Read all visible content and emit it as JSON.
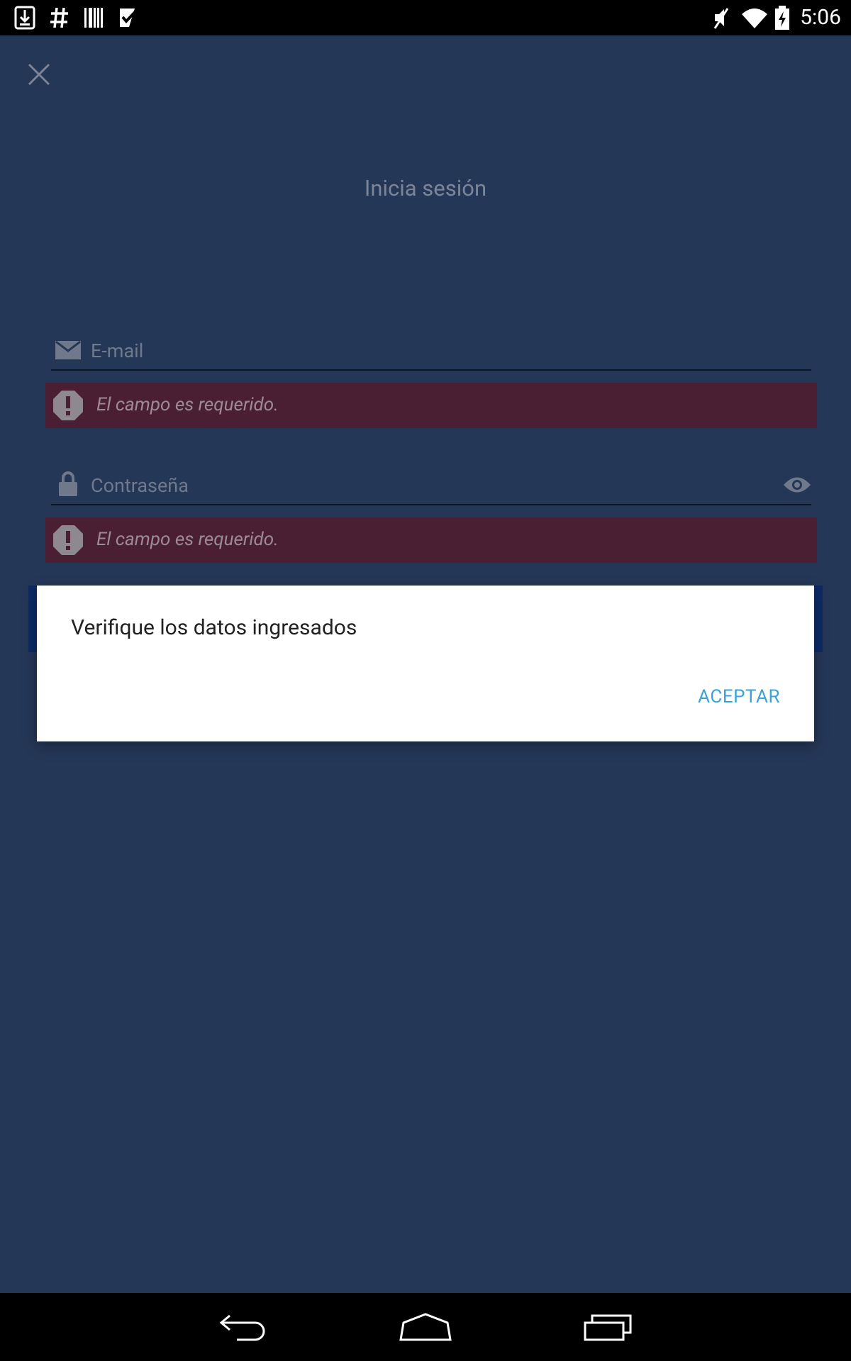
{
  "status_bar": {
    "time": "5:06",
    "icons": [
      "download-icon",
      "hash-icon",
      "barcode-icon",
      "task-icon",
      "mute-icon",
      "wifi-icon",
      "battery-charging-icon"
    ]
  },
  "screen": {
    "close_icon": "close-icon",
    "title": "Inicia sesión",
    "email": {
      "placeholder": "E-mail",
      "icon": "email-icon"
    },
    "email_error": "El campo es requerido.",
    "password": {
      "placeholder": "Contraseña",
      "icon": "lock-icon",
      "toggle_icon": "eye-icon"
    },
    "password_error": "El campo es requerido."
  },
  "dialog": {
    "message": "Verifique los datos ingresados",
    "button": "ACEPTAR"
  },
  "nav_bar": {
    "icons": [
      "back-icon",
      "home-icon",
      "recents-icon"
    ]
  },
  "colors": {
    "background": "#253757",
    "error_bg": "#4b1f33",
    "accent": "#38a4d9"
  }
}
